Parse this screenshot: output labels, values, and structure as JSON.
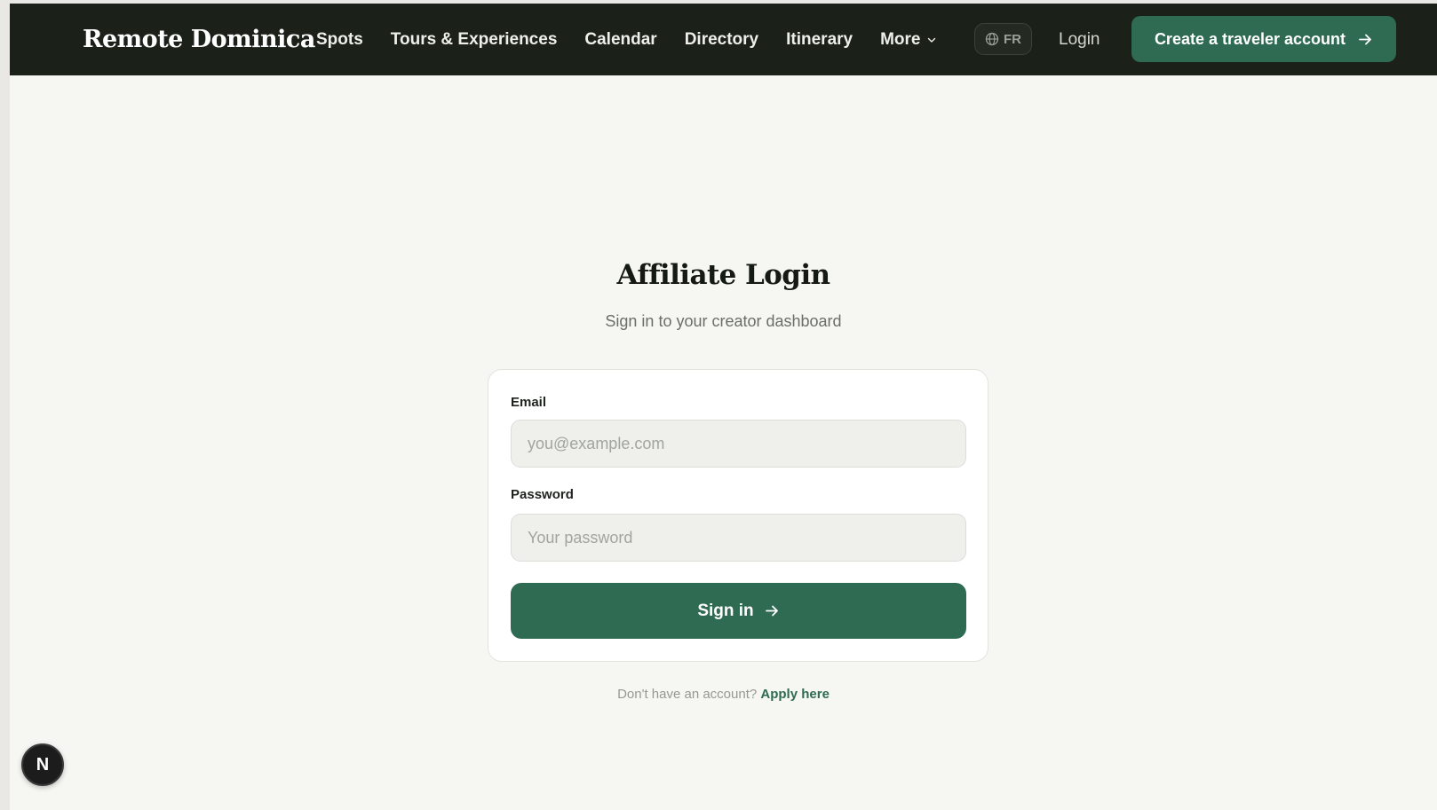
{
  "brand": {
    "name": "Remote Dominica"
  },
  "nav": {
    "links": [
      {
        "label": "Spots"
      },
      {
        "label": "Tours & Experiences"
      },
      {
        "label": "Calendar"
      },
      {
        "label": "Directory"
      },
      {
        "label": "Itinerary"
      },
      {
        "label": "More"
      }
    ],
    "language": "FR",
    "login": "Login",
    "cta": "Create a traveler account"
  },
  "page": {
    "title": "Affiliate Login",
    "subtitle": "Sign in to your creator dashboard"
  },
  "form": {
    "email_label": "Email",
    "email_placeholder": "you@example.com",
    "email_value": "",
    "password_label": "Password",
    "password_placeholder": "Your password",
    "password_value": "",
    "submit": "Sign in"
  },
  "footer": {
    "prompt": "Don't have an account?",
    "link": "Apply here"
  },
  "badge": {
    "letter": "N"
  },
  "colors": {
    "nav_bg": "#1b2119",
    "accent": "#2f6a53",
    "page_bg": "#f6f6f2"
  },
  "icons": [
    "chevron-down-icon",
    "globe-icon",
    "arrow-right-icon"
  ]
}
